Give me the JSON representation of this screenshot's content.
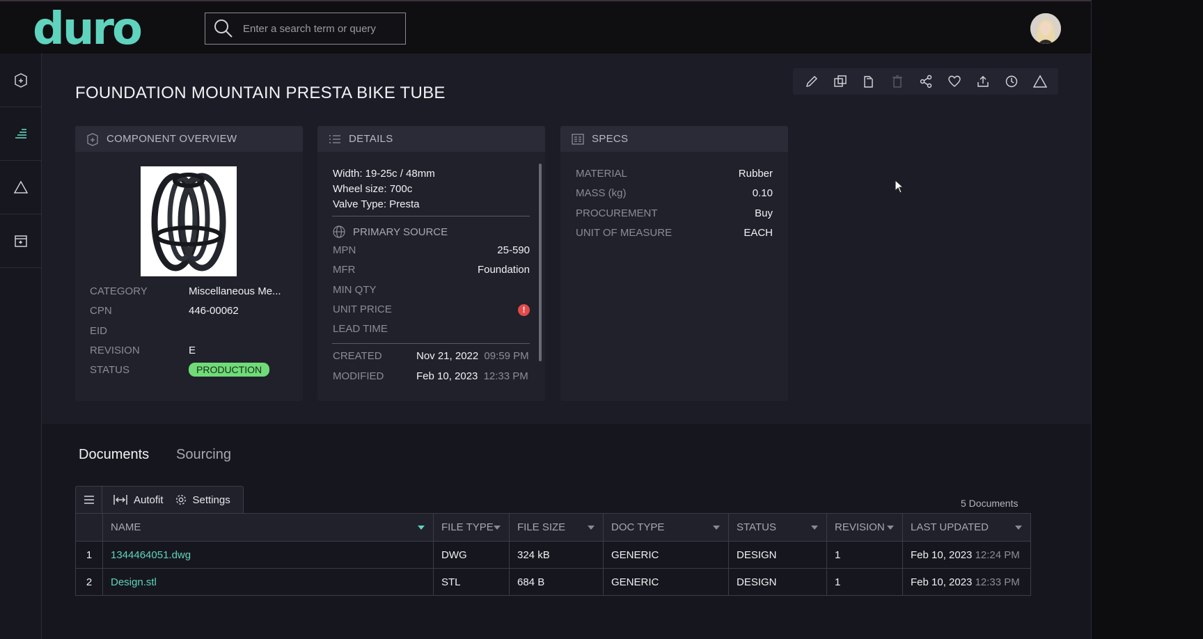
{
  "app": {
    "logo": "duro",
    "accent": "#5fd3bd"
  },
  "search": {
    "placeholder": "Enter a search term or query"
  },
  "page": {
    "title": "FOUNDATION MOUNTAIN PRESTA BIKE TUBE"
  },
  "overview": {
    "heading": "COMPONENT OVERVIEW",
    "fields": {
      "category_label": "CATEGORY",
      "category_value": "Miscellaneous Me...",
      "cpn_label": "CPN",
      "cpn_value": "446-00062",
      "eid_label": "EID",
      "eid_value": "",
      "revision_label": "REVISION",
      "revision_value": "E",
      "status_label": "STATUS",
      "status_value": "PRODUCTION"
    }
  },
  "details": {
    "heading": "DETAILS",
    "description": [
      "Width: 19-25c / 48mm",
      "Wheel size: 700c",
      "Valve Type: Presta"
    ],
    "primary_source_heading": "PRIMARY SOURCE",
    "mpn_label": "MPN",
    "mpn_value": "25-590",
    "mfr_label": "MFR",
    "mfr_value": "Foundation",
    "min_qty_label": "MIN QTY",
    "unit_price_label": "UNIT PRICE",
    "unit_price_warning": "!",
    "lead_time_label": "LEAD TIME",
    "created_label": "CREATED",
    "created_date": "Nov 21, 2022",
    "created_time": "09:59 PM",
    "modified_label": "MODIFIED",
    "modified_date": "Feb 10, 2023",
    "modified_time": "12:33 PM"
  },
  "specs": {
    "heading": "SPECS",
    "rows": [
      {
        "label": "MATERIAL",
        "value": "Rubber"
      },
      {
        "label": "MASS (kg)",
        "value": "0.10"
      },
      {
        "label": "PROCUREMENT",
        "value": "Buy"
      },
      {
        "label": "UNIT OF MEASURE",
        "value": "EACH"
      }
    ]
  },
  "tabs": {
    "documents": "Documents",
    "sourcing": "Sourcing"
  },
  "grid": {
    "autofit": "Autofit",
    "settings": "Settings",
    "count": "5 Documents",
    "columns": [
      "NAME",
      "FILE TYPE",
      "FILE SIZE",
      "DOC TYPE",
      "STATUS",
      "REVISION",
      "LAST UPDATED"
    ],
    "rows": [
      {
        "index": "1",
        "name": "1344464051.dwg",
        "file_type": "DWG",
        "file_size": "324 kB",
        "doc_type": "GENERIC",
        "status": "DESIGN",
        "revision": "1",
        "date": "Feb 10, 2023",
        "time": "12:24 PM"
      },
      {
        "index": "2",
        "name": "Design.stl",
        "file_type": "STL",
        "file_size": "684 B",
        "doc_type": "GENERIC",
        "status": "DESIGN",
        "revision": "1",
        "date": "Feb 10, 2023",
        "time": "12:33 PM"
      }
    ]
  }
}
